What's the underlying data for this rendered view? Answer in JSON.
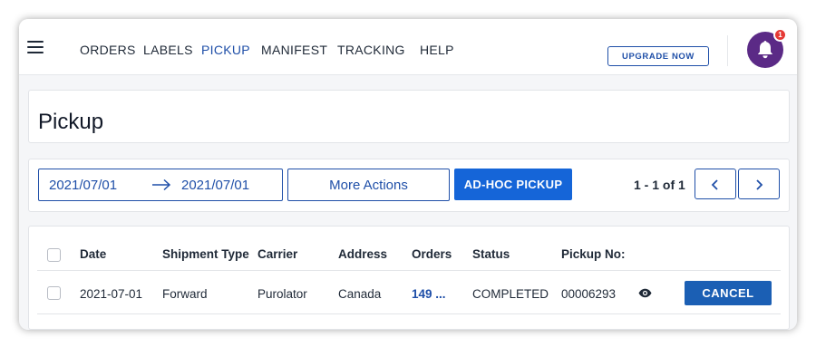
{
  "nav": {
    "items": [
      {
        "label": "ORDERS",
        "active": false
      },
      {
        "label": "LABELS",
        "active": false
      },
      {
        "label": "PICKUP",
        "active": true
      },
      {
        "label": "MANIFEST",
        "active": false
      },
      {
        "label": "TRACKING",
        "active": false
      },
      {
        "label": "HELP",
        "active": false
      }
    ],
    "upgrade_label": "UPGRADE NOW",
    "notification_count": "1"
  },
  "page": {
    "title": "Pickup"
  },
  "toolbar": {
    "date_from": "2021/07/01",
    "date_to": "2021/07/01",
    "more_actions_label": "More Actions",
    "adhoc_label": "AD-HOC PICKUP",
    "pager_text": "1 - 1 of 1"
  },
  "table": {
    "columns": [
      "Date",
      "Shipment Type",
      "Carrier",
      "Address",
      "Orders",
      "Status",
      "Pickup No:"
    ],
    "rows": [
      {
        "date": "2021-07-01",
        "shipment_type": "Forward",
        "carrier": "Purolator",
        "address": "Canada",
        "orders": "149 ...",
        "status": "COMPLETED",
        "pickup_no": "00006293",
        "action_label": "CANCEL"
      }
    ]
  },
  "colors": {
    "accent": "#1f4fa8",
    "primary_button": "#1565d8",
    "avatar": "#5b2a86",
    "badge": "#e53935"
  }
}
